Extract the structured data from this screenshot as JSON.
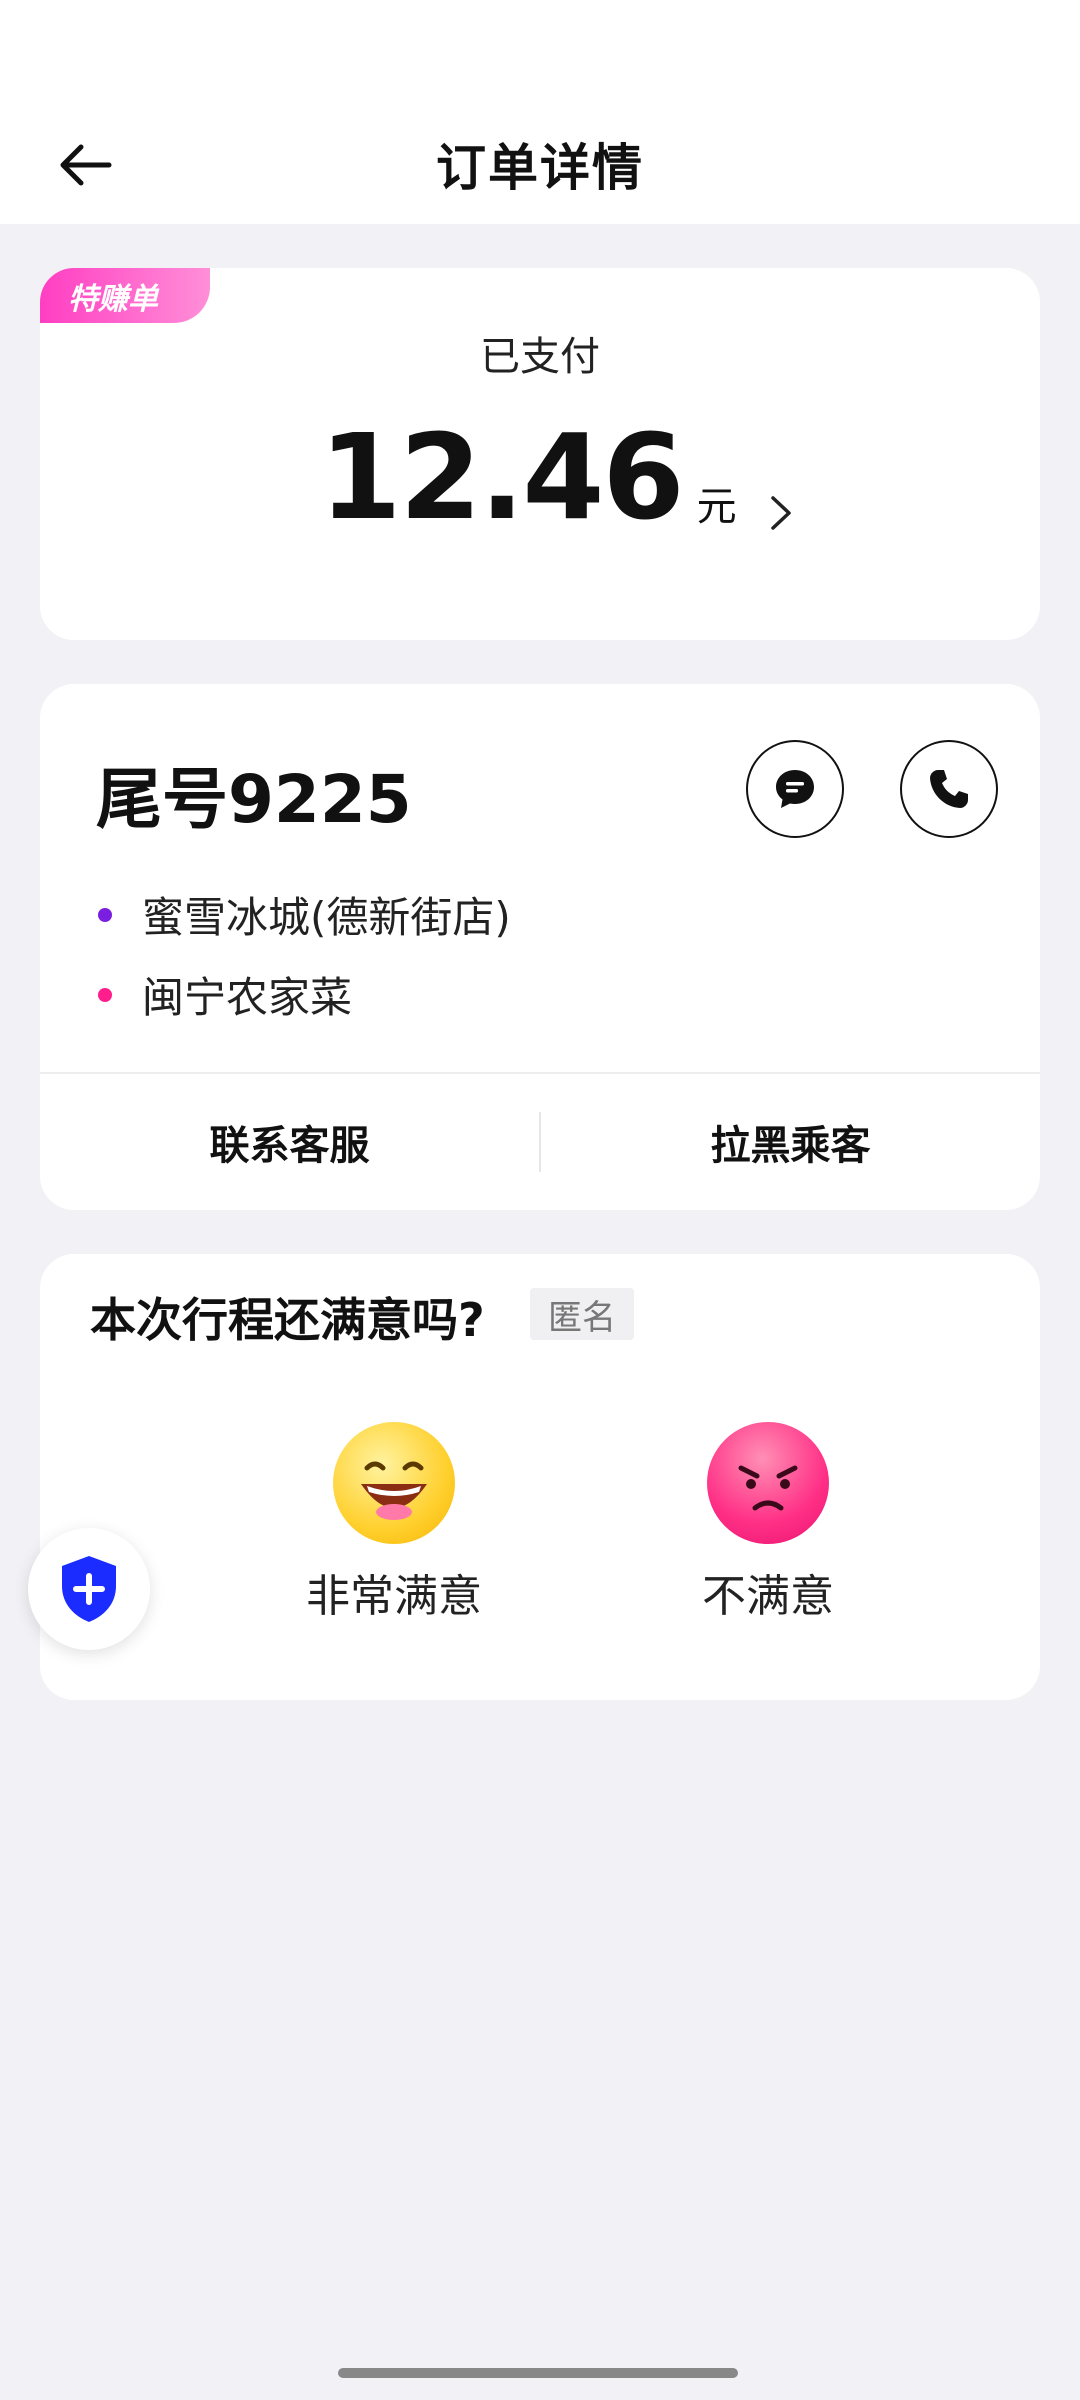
{
  "header": {
    "title": "订单详情",
    "back_icon": "arrow-left-icon"
  },
  "payment": {
    "badge": "特赚单",
    "status": "已支付",
    "amount": "12.46",
    "unit": "元",
    "chevron_icon": "chevron-right-icon"
  },
  "trip": {
    "passenger_tail": "尾号9225",
    "chat_icon": "message-icon",
    "phone_icon": "phone-icon",
    "stops": [
      {
        "label": "蜜雪冰城(德新街店)",
        "color": "#7a1fe0"
      },
      {
        "label": "闽宁农家菜",
        "color": "#ff1e8c"
      }
    ],
    "actions": [
      "联系客服",
      "拉黑乘客"
    ]
  },
  "rating": {
    "question": "本次行程还满意吗?",
    "anonymous_tag": "匿名",
    "options": [
      {
        "label": "非常满意",
        "icon": "happy-face-icon"
      },
      {
        "label": "不满意",
        "icon": "angry-face-icon"
      }
    ]
  },
  "safety": {
    "icon": "shield-plus-icon",
    "color": "#1a2cff"
  },
  "colors": {
    "accent_pink": "#ff3ec2",
    "background": "#f2f2f6"
  }
}
